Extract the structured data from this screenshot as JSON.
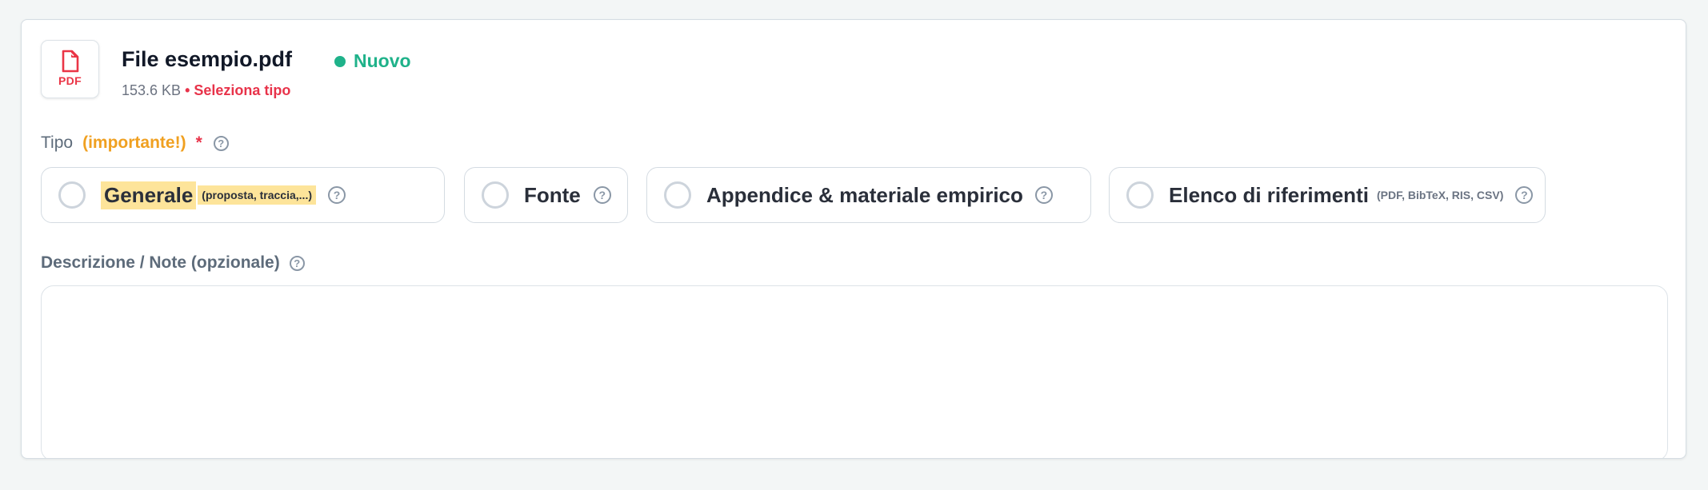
{
  "file": {
    "icon": "pdf-file-icon",
    "icon_ext": "PDF",
    "name": "File esempio.pdf",
    "status": "Nuovo",
    "size": "153.6 KB",
    "type_warning": "• Seleziona tipo"
  },
  "type_field": {
    "label": "Tipo",
    "important": "(importante!)",
    "required_mark": "*",
    "options": [
      {
        "label": "Generale",
        "hint": "(proposta, traccia,...)",
        "selected": false
      },
      {
        "label": "Fonte",
        "hint": "",
        "selected": false
      },
      {
        "label": "Appendice & materiale empirico",
        "hint": "",
        "selected": false
      },
      {
        "label": "Elenco di riferimenti",
        "hint": "(PDF, BibTeX, RIS, CSV)",
        "selected": false
      }
    ]
  },
  "description_field": {
    "label": "Descrizione / Note (opzionale)",
    "value": ""
  },
  "help_glyph": "?",
  "colors": {
    "success": "#1fb28a",
    "danger": "#e8334a",
    "warning": "#f0a020",
    "highlight": "#fde49a"
  }
}
